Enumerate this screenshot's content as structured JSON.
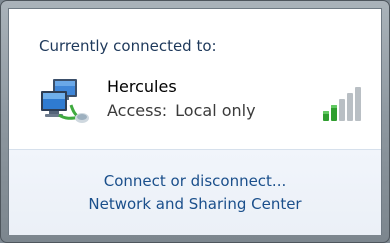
{
  "popup": {
    "header": "Currently connected to:",
    "icon": "network-computers-icon",
    "network": {
      "name": "Hercules",
      "access_label": "Access:",
      "access_value": "Local only",
      "signal_icon": "signal-strength-icon",
      "signal_bars_lit": 2,
      "signal_bars_total": 5
    },
    "links": {
      "connect": "Connect or disconnect...",
      "sharing_center": "Network and Sharing Center"
    }
  },
  "colors": {
    "link": "#1a4f8b",
    "header_text": "#1e395b",
    "signal_green": "#2f9e2f",
    "signal_gray": "#b9bfc4"
  }
}
